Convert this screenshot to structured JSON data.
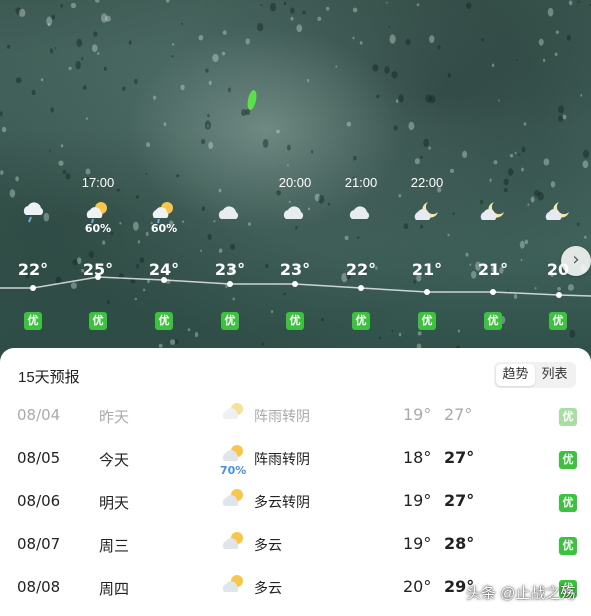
{
  "hourly": [
    {
      "time": "",
      "icon": "rain-icon",
      "pop": "",
      "temp": "22°",
      "aqi": "优"
    },
    {
      "time": "17:00",
      "icon": "sun-cloud-rain-icon",
      "pop": "60%",
      "temp": "25°",
      "aqi": "优"
    },
    {
      "time": "",
      "icon": "sun-cloud-rain-icon",
      "pop": "60%",
      "temp": "24°",
      "aqi": "优"
    },
    {
      "time": "",
      "icon": "cloud-icon",
      "pop": "",
      "temp": "23°",
      "aqi": "优"
    },
    {
      "time": "20:00",
      "icon": "cloud-icon",
      "pop": "",
      "temp": "23°",
      "aqi": "优"
    },
    {
      "time": "21:00",
      "icon": "cloud-icon",
      "pop": "",
      "temp": "22°",
      "aqi": "优"
    },
    {
      "time": "22:00",
      "icon": "moon-cloud-icon",
      "pop": "",
      "temp": "21°",
      "aqi": "优"
    },
    {
      "time": "",
      "icon": "moon-cloud-icon",
      "pop": "",
      "temp": "21°",
      "aqi": "优"
    },
    {
      "time": "",
      "icon": "moon-cloud-icon",
      "pop": "",
      "temp": "20",
      "aqi": "优"
    }
  ],
  "forecast": {
    "title": "15天预报",
    "toggle": {
      "trend": "趋势",
      "list": "列表"
    },
    "rows": [
      {
        "date": "08/04",
        "day": "昨天",
        "icon": "sun-cloud-rain-icon",
        "pop": "",
        "condition": "阵雨转阴",
        "low": "19°",
        "high": "27°",
        "aqi": "优",
        "past": true
      },
      {
        "date": "08/05",
        "day": "今天",
        "icon": "sun-cloud-rain-icon",
        "pop": "70%",
        "condition": "阵雨转阴",
        "low": "18°",
        "high": "27°",
        "aqi": "优",
        "past": false
      },
      {
        "date": "08/06",
        "day": "明天",
        "icon": "sun-cloud-icon",
        "pop": "",
        "condition": "多云转阴",
        "low": "19°",
        "high": "27°",
        "aqi": "优",
        "past": false
      },
      {
        "date": "08/07",
        "day": "周三",
        "icon": "sun-cloud-icon",
        "pop": "",
        "condition": "多云",
        "low": "19°",
        "high": "28°",
        "aqi": "优",
        "past": false
      },
      {
        "date": "08/08",
        "day": "周四",
        "icon": "sun-cloud-icon",
        "pop": "",
        "condition": "多云",
        "low": "20°",
        "high": "29°",
        "aqi": "优",
        "past": false
      }
    ]
  },
  "watermark": "头条 @止战之殇",
  "colors": {
    "aqi_good": "#3cc23e",
    "accent_blue": "#4a90e2",
    "sky": "#486a62"
  }
}
